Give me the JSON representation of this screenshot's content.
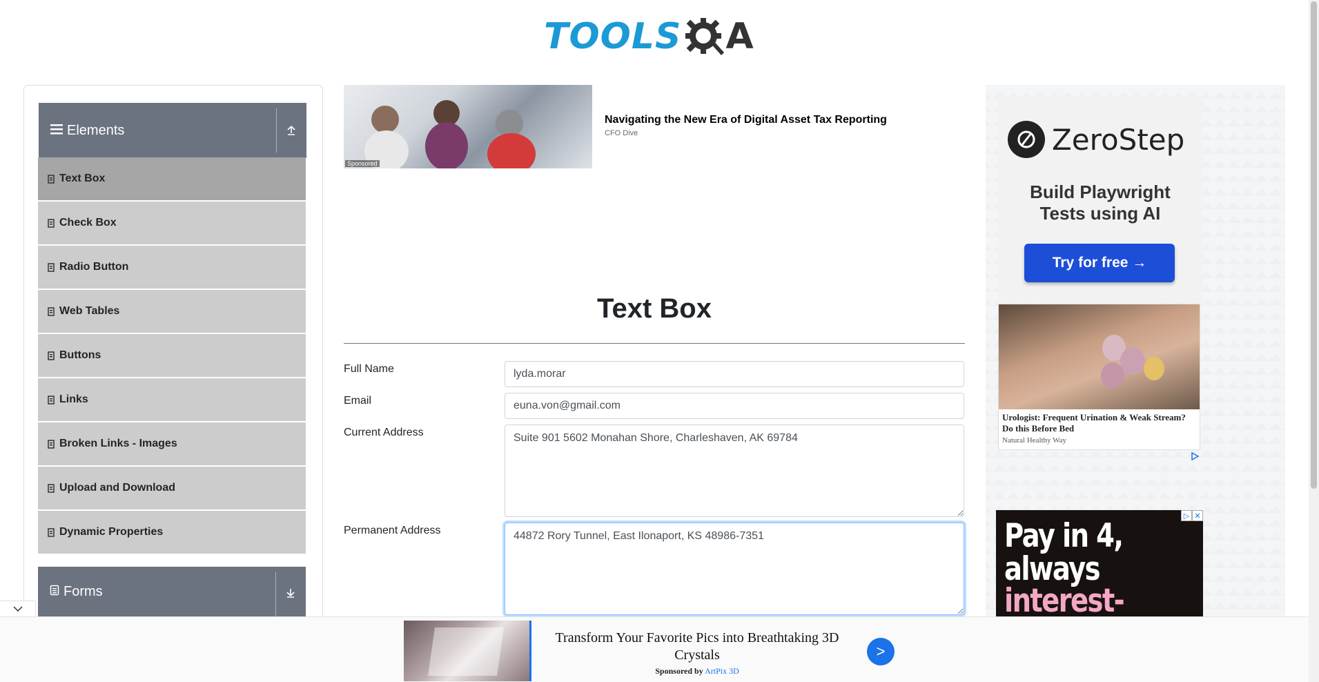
{
  "logo": {
    "text": "TOOLS",
    "suffix": "A",
    "accent": "#1b9ad5"
  },
  "sidebar": {
    "elements_header": {
      "label": "Elements",
      "icon": "list-icon",
      "toggle_icon": "collapse-up-icon"
    },
    "items": [
      {
        "label": "Text Box",
        "active": true
      },
      {
        "label": "Check Box"
      },
      {
        "label": "Radio Button"
      },
      {
        "label": "Web Tables"
      },
      {
        "label": "Buttons"
      },
      {
        "label": "Links"
      },
      {
        "label": "Broken Links - Images"
      },
      {
        "label": "Upload and Download"
      },
      {
        "label": "Dynamic Properties"
      }
    ],
    "forms_header": {
      "label": "Forms",
      "icon": "document-icon",
      "toggle_icon": "expand-down-icon"
    }
  },
  "sponsored_top": {
    "tag": "Sponsored",
    "title": "Navigating the New Era of Digital Asset Tax Reporting",
    "source": "CFO Dive"
  },
  "main": {
    "title": "Text Box",
    "fields": {
      "full_name": {
        "label": "Full Name",
        "value": "lyda.morar"
      },
      "email": {
        "label": "Email",
        "value": "euna.von@gmail.com"
      },
      "current_address": {
        "label": "Current Address",
        "value": "Suite 901 5602 Monahan Shore, Charleshaven, AK 69784"
      },
      "permanent_address": {
        "label": "Permanent Address",
        "value": "44872 Rory Tunnel, East Ilonaport, KS 48986-7351"
      }
    }
  },
  "right_ads": {
    "zerostep": {
      "brand": "ZeroStep",
      "headline_1": "Build Playwright",
      "headline_2": "Tests using AI",
      "cta": "Try for free →"
    },
    "onion": {
      "title": "Urologist: Frequent Urination & Weak Stream? Do this Before Bed",
      "source": "Natural Healthy Way"
    },
    "klarna": {
      "line1": "Pay in 4,",
      "line2": "always",
      "line3": "interest-free",
      "accent": "#f4a7c4"
    }
  },
  "bottom_ad": {
    "text": "Transform Your Favorite Pics into Breathtaking 3D Crystals",
    "sponsored_prefix": "Sponsored by",
    "sponsor": "ArtPix 3D",
    "cta": ">"
  }
}
